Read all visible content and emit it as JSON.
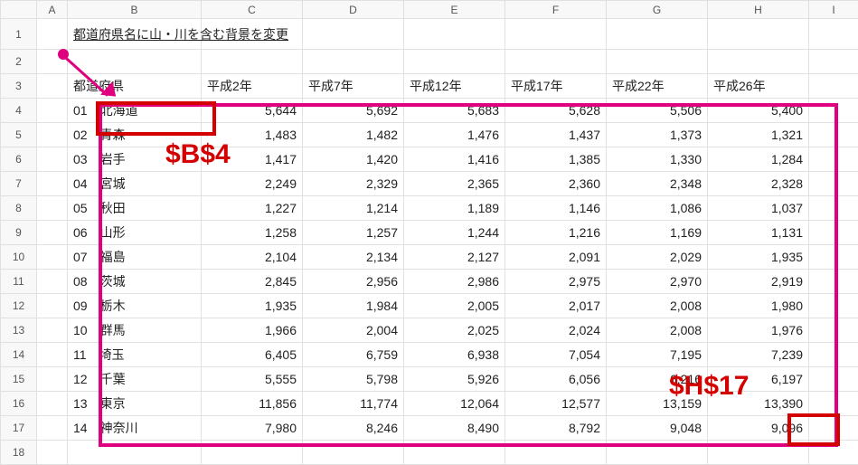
{
  "columns": [
    "",
    "A",
    "B",
    "C",
    "D",
    "E",
    "F",
    "G",
    "H",
    "I"
  ],
  "rows_header": [
    "1",
    "2",
    "3",
    "4",
    "5",
    "6",
    "7",
    "8",
    "9",
    "10",
    "11",
    "12",
    "13",
    "14",
    "15",
    "16",
    "17",
    "18"
  ],
  "title": "都道府県名に山・川を含む背景を変更",
  "headers": {
    "pref": "都道府県",
    "y1": "平成2年",
    "y2": "平成7年",
    "y3": "平成12年",
    "y4": "平成17年",
    "y5": "平成22年",
    "y6": "平成26年"
  },
  "annotations": {
    "ref1": "$B$4",
    "ref2": "$H$17"
  },
  "chart_data": {
    "type": "table",
    "categories": [
      "平成2年",
      "平成7年",
      "平成12年",
      "平成17年",
      "平成22年",
      "平成26年"
    ],
    "series": [
      {
        "code": "01",
        "name": "北海道",
        "values": [
          5644,
          5692,
          5683,
          5628,
          5506,
          5400
        ]
      },
      {
        "code": "02",
        "name": "青森",
        "values": [
          1483,
          1482,
          1476,
          1437,
          1373,
          1321
        ]
      },
      {
        "code": "03",
        "name": "岩手",
        "values": [
          1417,
          1420,
          1416,
          1385,
          1330,
          1284
        ]
      },
      {
        "code": "04",
        "name": "宮城",
        "values": [
          2249,
          2329,
          2365,
          2360,
          2348,
          2328
        ]
      },
      {
        "code": "05",
        "name": "秋田",
        "values": [
          1227,
          1214,
          1189,
          1146,
          1086,
          1037
        ]
      },
      {
        "code": "06",
        "name": "山形",
        "values": [
          1258,
          1257,
          1244,
          1216,
          1169,
          1131
        ]
      },
      {
        "code": "07",
        "name": "福島",
        "values": [
          2104,
          2134,
          2127,
          2091,
          2029,
          1935
        ]
      },
      {
        "code": "08",
        "name": "茨城",
        "values": [
          2845,
          2956,
          2986,
          2975,
          2970,
          2919
        ]
      },
      {
        "code": "09",
        "name": "栃木",
        "values": [
          1935,
          1984,
          2005,
          2017,
          2008,
          1980
        ]
      },
      {
        "code": "10",
        "name": "群馬",
        "values": [
          1966,
          2004,
          2025,
          2024,
          2008,
          1976
        ]
      },
      {
        "code": "11",
        "name": "埼玉",
        "values": [
          6405,
          6759,
          6938,
          7054,
          7195,
          7239
        ]
      },
      {
        "code": "12",
        "name": "千葉",
        "values": [
          5555,
          5798,
          5926,
          6056,
          6216,
          6197
        ]
      },
      {
        "code": "13",
        "name": "東京",
        "values": [
          11856,
          11774,
          12064,
          12577,
          13159,
          13390
        ]
      },
      {
        "code": "14",
        "name": "神奈川",
        "values": [
          7980,
          8246,
          8490,
          8792,
          9048,
          9096
        ]
      }
    ]
  }
}
